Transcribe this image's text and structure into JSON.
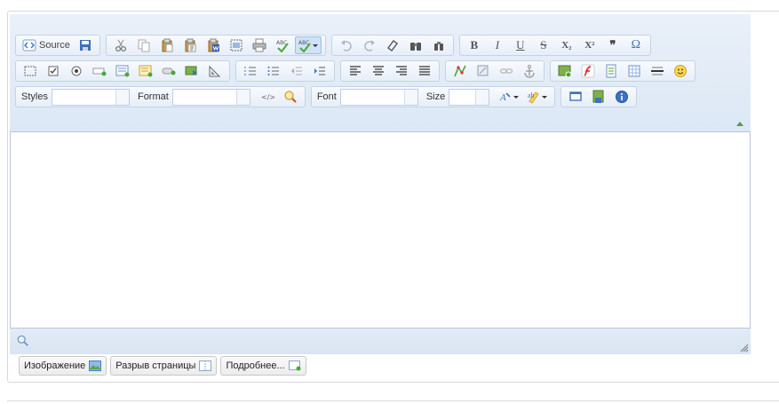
{
  "toolbar": {
    "source_label": "Source",
    "styles_label": "Styles",
    "format_label": "Format",
    "font_label": "Font",
    "size_label": "Size",
    "styles_value": "",
    "format_value": "",
    "font_value": "",
    "size_value": "",
    "bold_glyph": "B",
    "italic_glyph": "I",
    "underline_glyph": "U",
    "strike_glyph": "S",
    "subscript_glyph": "X₂",
    "superscript_glyph": "X²",
    "blockquote_glyph": "❞",
    "omega_glyph": "Ω"
  },
  "tabs": [
    {
      "label": "Изображение"
    },
    {
      "label": "Разрыв страницы"
    },
    {
      "label": "Подробнее..."
    }
  ],
  "colors": {
    "accent": "#4a7fc1",
    "toolbar_bg": "#dce8f5",
    "border": "#b7c7dc"
  }
}
